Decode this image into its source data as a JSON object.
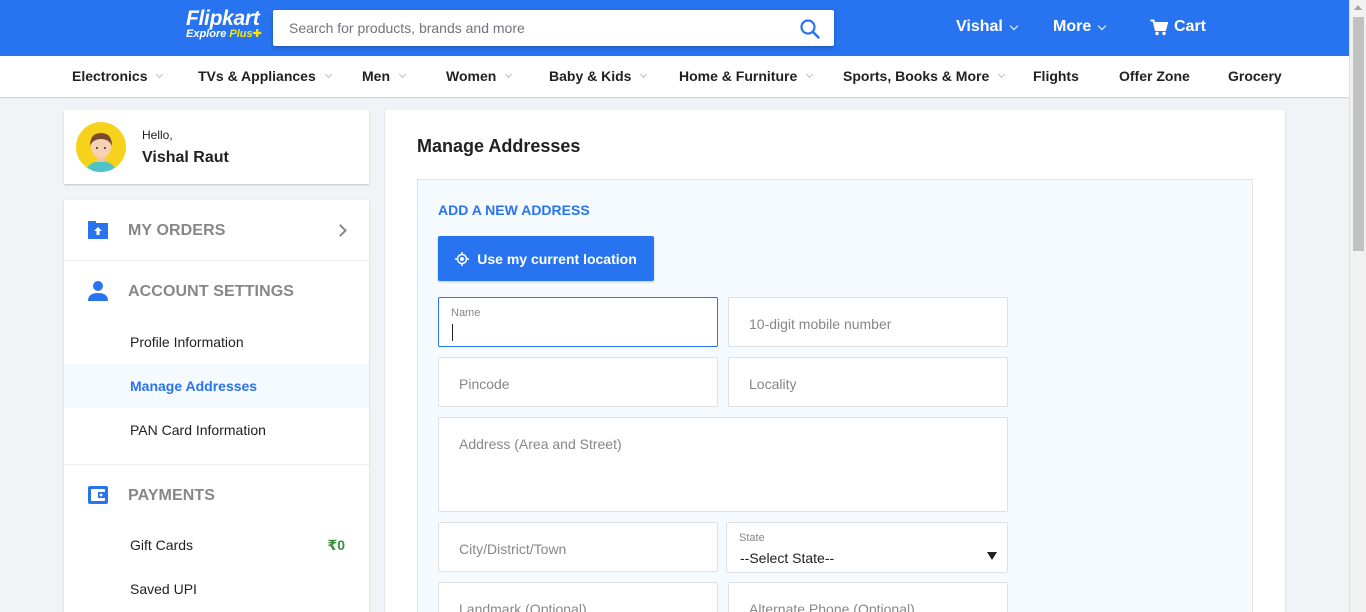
{
  "header": {
    "logo_brand": "Flipkart",
    "logo_sub_prefix": "Explore ",
    "logo_sub_plus": "Plus",
    "search_placeholder": "Search for products, brands and more",
    "user_label": "Vishal",
    "more_label": "More",
    "cart_label": "Cart",
    "brand_color": "#2874f0"
  },
  "categories": [
    {
      "label": "Electronics",
      "dropdown": true
    },
    {
      "label": "TVs & Appliances",
      "dropdown": true
    },
    {
      "label": "Men",
      "dropdown": true
    },
    {
      "label": "Women",
      "dropdown": true
    },
    {
      "label": "Baby & Kids",
      "dropdown": true
    },
    {
      "label": "Home & Furniture",
      "dropdown": true
    },
    {
      "label": "Sports, Books & More",
      "dropdown": true
    },
    {
      "label": "Flights",
      "dropdown": false
    },
    {
      "label": "Offer Zone",
      "dropdown": false
    },
    {
      "label": "Grocery",
      "dropdown": false
    }
  ],
  "profile": {
    "greeting": "Hello,",
    "name": "Vishal Raut"
  },
  "sidebar": {
    "my_orders": "MY ORDERS",
    "account_settings": "ACCOUNT SETTINGS",
    "account_items": [
      {
        "label": "Profile Information",
        "active": false
      },
      {
        "label": "Manage Addresses",
        "active": true
      },
      {
        "label": "PAN Card Information",
        "active": false
      }
    ],
    "payments": "PAYMENTS",
    "payment_items": [
      {
        "label": "Gift Cards",
        "amount": "₹0"
      },
      {
        "label": "Saved UPI",
        "amount": ""
      }
    ]
  },
  "main": {
    "title": "Manage Addresses",
    "add_title": "ADD A NEW ADDRESS",
    "location_button": "Use my current location",
    "fields": {
      "name_label": "Name",
      "mobile_placeholder": "10-digit mobile number",
      "pincode_placeholder": "Pincode",
      "locality_placeholder": "Locality",
      "address_placeholder": "Address (Area and Street)",
      "city_placeholder": "City/District/Town",
      "state_label": "State",
      "state_value": "--Select State--",
      "landmark_placeholder": "Landmark (Optional)",
      "alt_phone_placeholder": "Alternate Phone (Optional)"
    }
  }
}
